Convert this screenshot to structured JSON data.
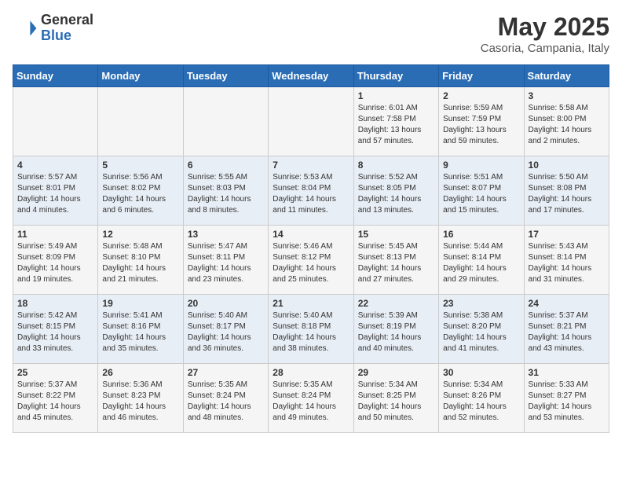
{
  "logo": {
    "general": "General",
    "blue": "Blue"
  },
  "title": "May 2025",
  "location": "Casoria, Campania, Italy",
  "weekdays": [
    "Sunday",
    "Monday",
    "Tuesday",
    "Wednesday",
    "Thursday",
    "Friday",
    "Saturday"
  ],
  "weeks": [
    [
      {
        "day": "",
        "info": ""
      },
      {
        "day": "",
        "info": ""
      },
      {
        "day": "",
        "info": ""
      },
      {
        "day": "",
        "info": ""
      },
      {
        "day": "1",
        "info": "Sunrise: 6:01 AM\nSunset: 7:58 PM\nDaylight: 13 hours\nand 57 minutes."
      },
      {
        "day": "2",
        "info": "Sunrise: 5:59 AM\nSunset: 7:59 PM\nDaylight: 13 hours\nand 59 minutes."
      },
      {
        "day": "3",
        "info": "Sunrise: 5:58 AM\nSunset: 8:00 PM\nDaylight: 14 hours\nand 2 minutes."
      }
    ],
    [
      {
        "day": "4",
        "info": "Sunrise: 5:57 AM\nSunset: 8:01 PM\nDaylight: 14 hours\nand 4 minutes."
      },
      {
        "day": "5",
        "info": "Sunrise: 5:56 AM\nSunset: 8:02 PM\nDaylight: 14 hours\nand 6 minutes."
      },
      {
        "day": "6",
        "info": "Sunrise: 5:55 AM\nSunset: 8:03 PM\nDaylight: 14 hours\nand 8 minutes."
      },
      {
        "day": "7",
        "info": "Sunrise: 5:53 AM\nSunset: 8:04 PM\nDaylight: 14 hours\nand 11 minutes."
      },
      {
        "day": "8",
        "info": "Sunrise: 5:52 AM\nSunset: 8:05 PM\nDaylight: 14 hours\nand 13 minutes."
      },
      {
        "day": "9",
        "info": "Sunrise: 5:51 AM\nSunset: 8:07 PM\nDaylight: 14 hours\nand 15 minutes."
      },
      {
        "day": "10",
        "info": "Sunrise: 5:50 AM\nSunset: 8:08 PM\nDaylight: 14 hours\nand 17 minutes."
      }
    ],
    [
      {
        "day": "11",
        "info": "Sunrise: 5:49 AM\nSunset: 8:09 PM\nDaylight: 14 hours\nand 19 minutes."
      },
      {
        "day": "12",
        "info": "Sunrise: 5:48 AM\nSunset: 8:10 PM\nDaylight: 14 hours\nand 21 minutes."
      },
      {
        "day": "13",
        "info": "Sunrise: 5:47 AM\nSunset: 8:11 PM\nDaylight: 14 hours\nand 23 minutes."
      },
      {
        "day": "14",
        "info": "Sunrise: 5:46 AM\nSunset: 8:12 PM\nDaylight: 14 hours\nand 25 minutes."
      },
      {
        "day": "15",
        "info": "Sunrise: 5:45 AM\nSunset: 8:13 PM\nDaylight: 14 hours\nand 27 minutes."
      },
      {
        "day": "16",
        "info": "Sunrise: 5:44 AM\nSunset: 8:14 PM\nDaylight: 14 hours\nand 29 minutes."
      },
      {
        "day": "17",
        "info": "Sunrise: 5:43 AM\nSunset: 8:14 PM\nDaylight: 14 hours\nand 31 minutes."
      }
    ],
    [
      {
        "day": "18",
        "info": "Sunrise: 5:42 AM\nSunset: 8:15 PM\nDaylight: 14 hours\nand 33 minutes."
      },
      {
        "day": "19",
        "info": "Sunrise: 5:41 AM\nSunset: 8:16 PM\nDaylight: 14 hours\nand 35 minutes."
      },
      {
        "day": "20",
        "info": "Sunrise: 5:40 AM\nSunset: 8:17 PM\nDaylight: 14 hours\nand 36 minutes."
      },
      {
        "day": "21",
        "info": "Sunrise: 5:40 AM\nSunset: 8:18 PM\nDaylight: 14 hours\nand 38 minutes."
      },
      {
        "day": "22",
        "info": "Sunrise: 5:39 AM\nSunset: 8:19 PM\nDaylight: 14 hours\nand 40 minutes."
      },
      {
        "day": "23",
        "info": "Sunrise: 5:38 AM\nSunset: 8:20 PM\nDaylight: 14 hours\nand 41 minutes."
      },
      {
        "day": "24",
        "info": "Sunrise: 5:37 AM\nSunset: 8:21 PM\nDaylight: 14 hours\nand 43 minutes."
      }
    ],
    [
      {
        "day": "25",
        "info": "Sunrise: 5:37 AM\nSunset: 8:22 PM\nDaylight: 14 hours\nand 45 minutes."
      },
      {
        "day": "26",
        "info": "Sunrise: 5:36 AM\nSunset: 8:23 PM\nDaylight: 14 hours\nand 46 minutes."
      },
      {
        "day": "27",
        "info": "Sunrise: 5:35 AM\nSunset: 8:24 PM\nDaylight: 14 hours\nand 48 minutes."
      },
      {
        "day": "28",
        "info": "Sunrise: 5:35 AM\nSunset: 8:24 PM\nDaylight: 14 hours\nand 49 minutes."
      },
      {
        "day": "29",
        "info": "Sunrise: 5:34 AM\nSunset: 8:25 PM\nDaylight: 14 hours\nand 50 minutes."
      },
      {
        "day": "30",
        "info": "Sunrise: 5:34 AM\nSunset: 8:26 PM\nDaylight: 14 hours\nand 52 minutes."
      },
      {
        "day": "31",
        "info": "Sunrise: 5:33 AM\nSunset: 8:27 PM\nDaylight: 14 hours\nand 53 minutes."
      }
    ]
  ]
}
